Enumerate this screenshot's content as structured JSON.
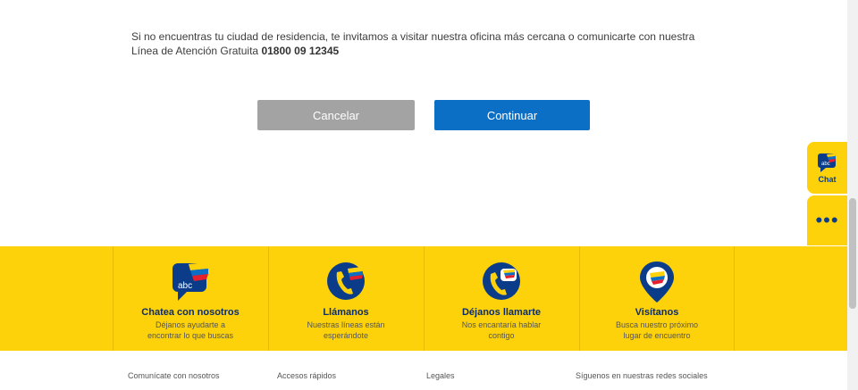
{
  "notice": {
    "text": "Si no encuentras tu ciudad de residencia, te invitamos a visitar nuestra oficina más cercana o comunicarte con nuestra",
    "line2_label": "Línea de Atención Gratuita",
    "phone": "01800 09 12345"
  },
  "actions": {
    "cancel_label": "Cancelar",
    "continue_label": "Continuar"
  },
  "side": {
    "chat_label": "Chat",
    "chat_icon_text": "abc",
    "more_icon": "ellipsis-icon"
  },
  "contact_cards": [
    {
      "title": "Chatea con nosotros",
      "subtitle": "Déjanos ayudarte a encontrar lo que buscas",
      "icon": "chat-bubble-icon",
      "icon_text": "abc"
    },
    {
      "title": "Llámanos",
      "subtitle": "Nuestras líneas están esperándote",
      "icon": "phone-icon"
    },
    {
      "title": "Déjanos llamarte",
      "subtitle": "Nos encantaría hablar contigo",
      "icon": "callback-icon"
    },
    {
      "title": "Visítanos",
      "subtitle": "Busca nuestro próximo lugar de encuentro",
      "icon": "location-pin-icon"
    }
  ],
  "footer": {
    "links": [
      "Comunícate con nosotros",
      "Accesos rápidos",
      "Legales",
      "Síguenos en nuestras redes sociales"
    ]
  },
  "colors": {
    "brand_yellow": "#fdd20a",
    "brand_blue": "#0a3c8a",
    "button_blue": "#0c6fc6",
    "button_gray": "#a3a3a3",
    "flag_red": "#e4202e"
  }
}
